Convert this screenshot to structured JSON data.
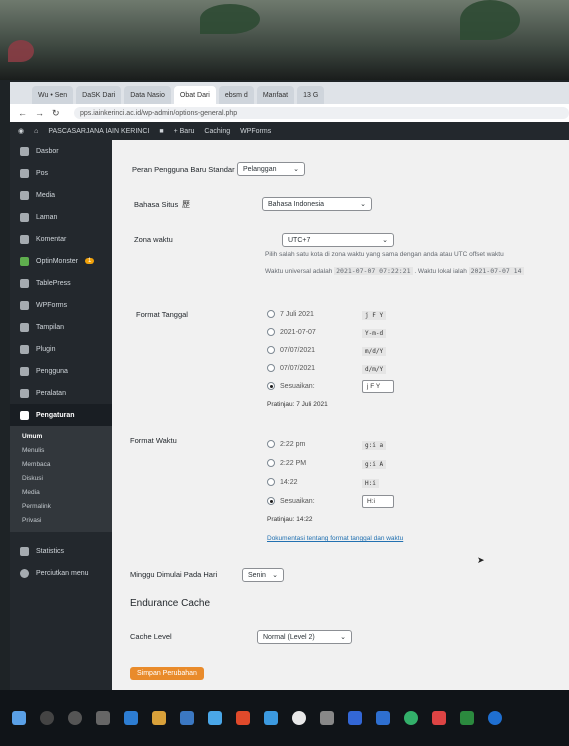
{
  "browser": {
    "tabs": [
      "Wu • Sen",
      "DaSK Dari",
      "Data Nasio",
      "Obat Dari",
      "ebsm d",
      "Manfaat",
      "13 G"
    ],
    "url": "pps.iainkerinci.ac.id/wp-admin/options-general.php"
  },
  "adminbar": {
    "site": "PASCASARJANA IAIN KERINCI",
    "items": [
      "+ Baru",
      "Caching",
      "WPForms"
    ]
  },
  "sidebar": {
    "items": [
      {
        "label": "Dasbor"
      },
      {
        "label": "Pos"
      },
      {
        "label": "Media"
      },
      {
        "label": "Laman"
      },
      {
        "label": "Komentar"
      },
      {
        "label": "OptinMonster",
        "badge": "1"
      },
      {
        "label": "TablePress"
      },
      {
        "label": "WPForms"
      },
      {
        "label": "Tampilan"
      },
      {
        "label": "Plugin"
      },
      {
        "label": "Pengguna"
      },
      {
        "label": "Peralatan"
      },
      {
        "label": "Pengaturan"
      }
    ],
    "submenu": [
      "Umum",
      "Menulis",
      "Membaca",
      "Diskusi",
      "Media",
      "Permalink",
      "Privasi"
    ],
    "bottom": [
      {
        "label": "Statistics"
      },
      {
        "label": "Perciutkan menu"
      }
    ]
  },
  "settings": {
    "default_role_label": "Peran Pengguna Baru Standar",
    "default_role_value": "Pelanggan",
    "language_label": "Bahasa Situs",
    "language_value": "Bahasa Indonesia",
    "timezone_label": "Zona waktu",
    "timezone_value": "UTC+7",
    "timezone_help": "Pilih salah satu kota di zona waktu yang sama dengan anda atau UTC offset waktu",
    "utc_time_prefix": "Waktu universal adalah",
    "utc_time": "2021-07-07 07:22:21",
    "local_time_prefix": ". Waktu lokal ialah",
    "local_time": "2021-07-07 14",
    "date_format_label": "Format Tanggal",
    "date_options": [
      {
        "label": "7 Juli 2021",
        "code": "j F Y"
      },
      {
        "label": "2021-07-07",
        "code": "Y-m-d"
      },
      {
        "label": "07/07/2021",
        "code": "m/d/Y"
      },
      {
        "label": "07/07/2021",
        "code": "d/m/Y"
      },
      {
        "label": "Sesuaikan:",
        "code": "j F Y"
      }
    ],
    "date_preview": "Pratinjau: 7 Juli 2021",
    "time_format_label": "Format Waktu",
    "time_options": [
      {
        "label": "2:22 pm",
        "code": "g:i a"
      },
      {
        "label": "2:22 PM",
        "code": "g:i A"
      },
      {
        "label": "14:22",
        "code": "H:i"
      },
      {
        "label": "Sesuaikan:",
        "code": "H:i"
      }
    ],
    "time_preview": "Pratinjau: 14:22",
    "doc_link": "Dokumentasi tentang format tanggal dan waktu",
    "week_start_label": "Minggu Dimulai Pada Hari",
    "week_start_value": "Senin",
    "cache_heading": "Endurance Cache",
    "cache_level_label": "Cache Level",
    "cache_level_value": "Normal (Level 2)",
    "save_label": "Simpan Perubahan"
  }
}
